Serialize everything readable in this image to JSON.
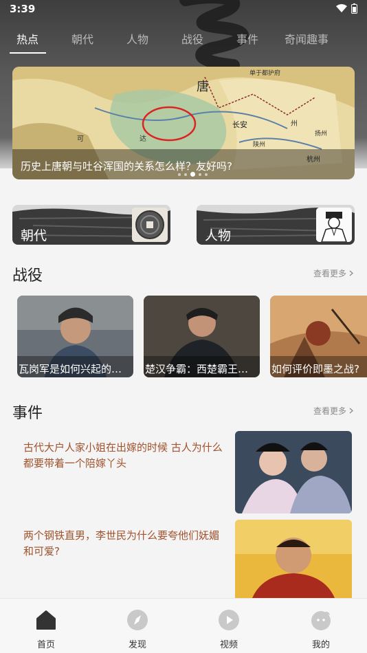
{
  "status": {
    "time": "3:39"
  },
  "tabs": [
    {
      "label": "热点",
      "active": true
    },
    {
      "label": "朝代"
    },
    {
      "label": "人物"
    },
    {
      "label": "战役"
    },
    {
      "label": "事件"
    },
    {
      "label": "奇闻趣事"
    }
  ],
  "banner": {
    "caption": "历史上唐朝与吐谷浑国的关系怎么样？友好吗?",
    "map_labels": [
      "唐",
      "长安",
      "单于都护府",
      "可",
      "达",
      "州",
      "杭州",
      "广州",
      "陕州",
      "扬州"
    ],
    "dots": 5,
    "active_dot": 2
  },
  "categories": [
    {
      "label": "朝代",
      "icon": "coin-icon"
    },
    {
      "label": "人物",
      "icon": "portrait-icon"
    }
  ],
  "battles": {
    "title": "战役",
    "more": "查看更多",
    "items": [
      {
        "title": "瓦岗军是如何兴起的？..."
      },
      {
        "title": "楚汉争霸：西楚霸王项..."
      },
      {
        "title": "如何评价即墨之战?"
      }
    ]
  },
  "events": {
    "title": "事件",
    "more": "查看更多",
    "items": [
      {
        "title": "古代大户人家小姐在出嫁的时候 古人为什么都要带着一个陪嫁丫头"
      },
      {
        "title": "两个钢铁直男，李世民为什么要夸他们妩媚和可爱?"
      }
    ]
  },
  "nav": [
    {
      "label": "首页",
      "icon": "home-icon",
      "active": true
    },
    {
      "label": "发现",
      "icon": "compass-icon"
    },
    {
      "label": "视频",
      "icon": "play-icon"
    },
    {
      "label": "我的",
      "icon": "profile-icon"
    }
  ],
  "colors": {
    "event_text": "#a0522d",
    "header_dark": "#3e3e3e",
    "active_tab": "#ffffff"
  }
}
